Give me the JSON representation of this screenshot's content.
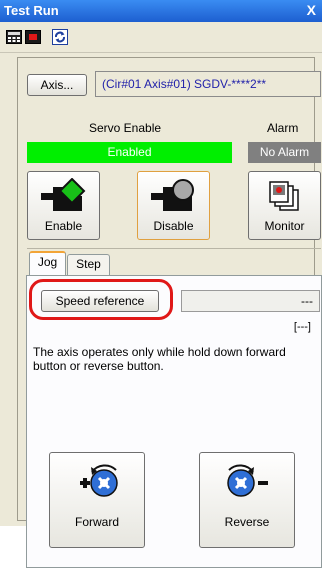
{
  "window": {
    "title": "Test Run",
    "close_glyph": "X"
  },
  "toolbar": {
    "icons": [
      "numeric-display-icon",
      "record-icon",
      "refresh-icon"
    ]
  },
  "axis": {
    "button_label": "Axis...",
    "info": "(Cir#01 Axis#01) SGDV-****2**"
  },
  "status": {
    "servo_label": "Servo Enable",
    "alarm_label": "Alarm",
    "servo_value": "Enabled",
    "alarm_value": "No Alarm",
    "servo_color": "#00ef00",
    "alarm_color": "#808080"
  },
  "actions": {
    "enable": "Enable",
    "disable": "Disable",
    "monitor": "Monitor"
  },
  "tabs": [
    {
      "label": "Jog"
    },
    {
      "label": "Step"
    }
  ],
  "jog": {
    "speed_button": "Speed reference",
    "speed_value": "---",
    "speed_unit": "[---]",
    "description": "The axis operates only while hold down forward button or reverse button.",
    "forward": "Forward",
    "reverse": "Reverse"
  },
  "colors": {
    "highlight": "#e01818",
    "title_bar": "#1d5fd0"
  }
}
